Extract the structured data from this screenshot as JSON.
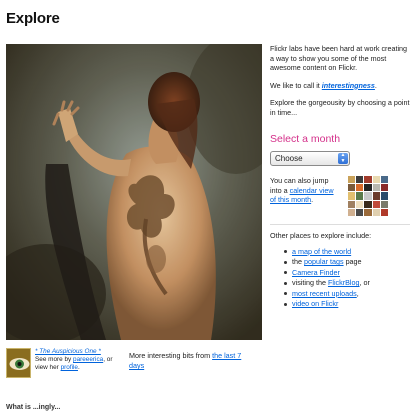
{
  "page": {
    "title": "Explore"
  },
  "photo": {
    "title": "* The Auspicious One *",
    "see_more_prefix": "See more by",
    "author": "pareeerica",
    "or_text": ", or",
    "view_prefix": "view her",
    "profile_link": "profile",
    "period": "."
  },
  "more": {
    "text": "More interesting bits from",
    "link": "the last 7 days"
  },
  "sidebar": {
    "intro": "Flickr labs have been hard at work creating a way to show you some of the most awesome content on Flickr.",
    "call_prefix": "We like to call it",
    "interestingness": "interestingness",
    "call_suffix": ".",
    "gorgeousity": "Explore the gorgeousity by choosing a point in time...",
    "select_heading": "Select a month",
    "select_value": "Choose",
    "calendar_prefix": "You can also jump into a",
    "calendar_link": "calendar view of this month",
    "calendar_suffix": ".",
    "places_heading": "Other places to explore include:",
    "places": [
      {
        "prefix": "",
        "link": "a map of the world",
        "suffix": ""
      },
      {
        "prefix": "the",
        "link": "popular tags",
        "suffix": "page"
      },
      {
        "prefix": "",
        "link": "Camera Finder",
        "suffix": ""
      },
      {
        "prefix": "visiting the",
        "link": "FlickrBlog",
        "suffix": ", or"
      },
      {
        "prefix": "",
        "link": "most recent uploads",
        "suffix": ","
      },
      {
        "prefix": "",
        "link": "video on Flickr",
        "suffix": ""
      }
    ]
  },
  "footer": {
    "heading": "What is ...ingly..."
  },
  "colors": {
    "link": "#0063dc",
    "heading_pink": "#d4308a",
    "photo_background": "#3d3c31"
  },
  "icons": {
    "select_arrows": "up-down-chevron-icon",
    "bullet": "bullet-icon"
  }
}
